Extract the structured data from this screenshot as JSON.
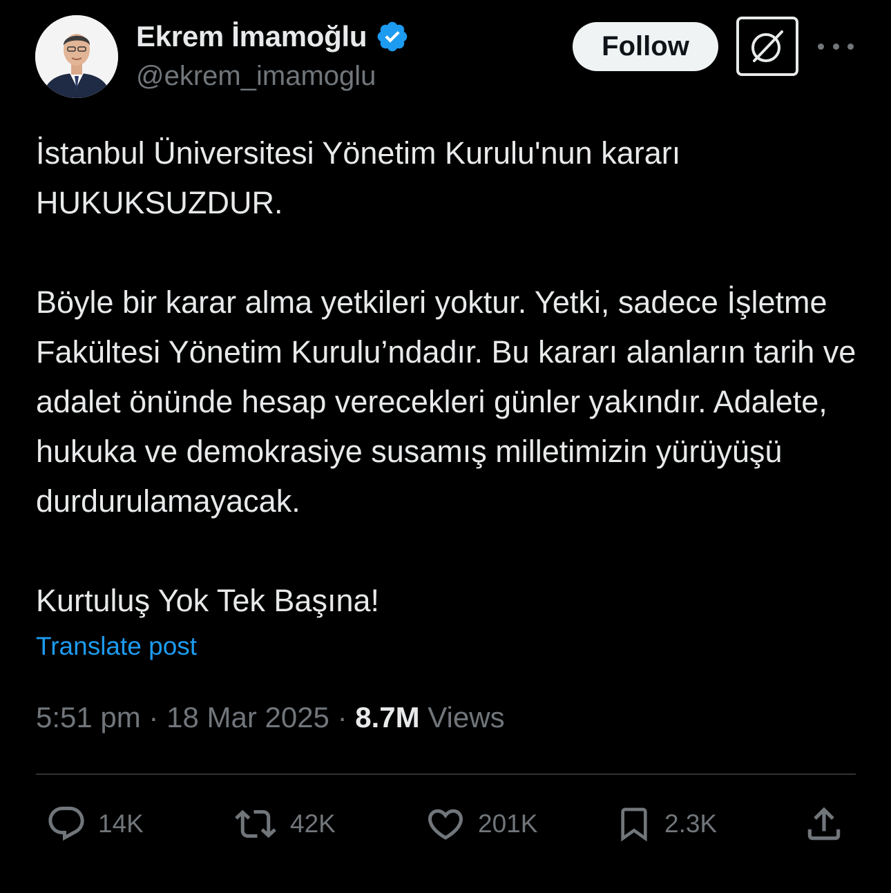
{
  "author": {
    "display_name": "Ekrem İmamoğlu",
    "handle": "@ekrem_imamoglu",
    "verified": true,
    "verified_color": "#1d9bf0"
  },
  "header": {
    "follow_label": "Follow",
    "grok_icon": "grok-icon",
    "more_icon": "more-dots-icon"
  },
  "tweet": {
    "paragraphs": [
      "İstanbul Üniversitesi Yönetim Kurulu'nun kararı HUKUKSUZDUR.",
      "Böyle bir karar alma yetkileri yoktur. Yetki, sadece İşletme Fakültesi Yönetim Kurulu’ndadır. Bu kararı alanların tarih ve adalet önünde hesap verecekleri günler yakındır. Adalete, hukuka ve demokrasiye susamış milletimizin yürüyüşü durdurulamayacak.",
      "Kurtuluş Yok Tek Başına!"
    ],
    "translate_label": "Translate post",
    "time": "5:51 pm",
    "separator": " · ",
    "date": "18 Mar 2025",
    "views_count": "8.7M",
    "views_label": "Views"
  },
  "actions": {
    "replies": "14K",
    "reposts": "42K",
    "likes": "201K",
    "bookmarks": "2.3K"
  },
  "colors": {
    "background": "#000000",
    "text": "#e7e9ea",
    "secondary": "#71767b",
    "link": "#1d9bf0",
    "divider": "#2f3336"
  }
}
